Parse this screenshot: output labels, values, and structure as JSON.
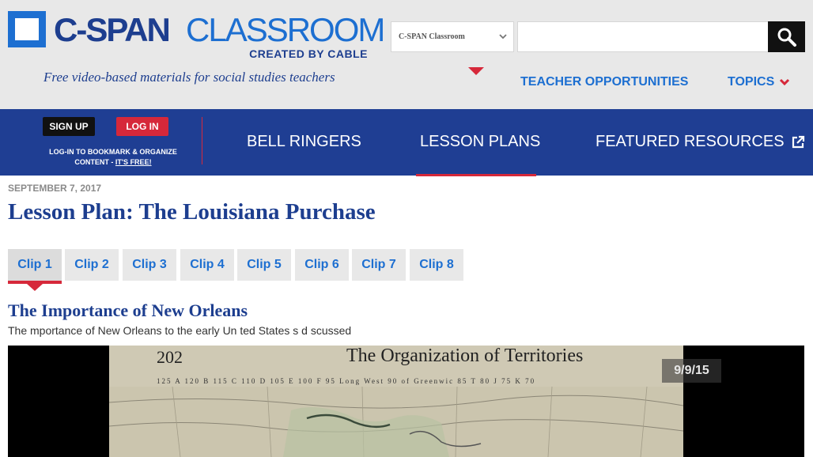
{
  "logo": {
    "brand_part1": "C-SPAN",
    "brand_part2": "CLASSROOM",
    "byline": "CREATED BY CABLE"
  },
  "header": {
    "tagline": "Free video-based materials for social studies teachers",
    "site_select_value": "C-SPAN Classroom",
    "search_placeholder": "",
    "teacher_opportunities": "TEACHER OPPORTUNITIES",
    "topics": "TOPICS"
  },
  "auth": {
    "signup": "SIGN UP",
    "login": "LOG IN",
    "note": "LOG-IN TO BOOKMARK & ORGANIZE CONTENT - ",
    "note_link": "IT'S FREE!"
  },
  "nav": {
    "items": [
      {
        "label": "BELL RINGERS"
      },
      {
        "label": "LESSON PLANS"
      },
      {
        "label": "FEATURED RESOURCES"
      }
    ],
    "active": "LESSON PLANS"
  },
  "content": {
    "date": "SEPTEMBER 7, 2017",
    "title": "Lesson Plan: The Louisiana Purchase",
    "clips": [
      "Clip 1",
      "Clip 2",
      "Clip 3",
      "Clip 4",
      "Clip 5",
      "Clip 6",
      "Clip 7",
      "Clip 8"
    ],
    "active_clip": "Clip 1",
    "clip_title": "The Importance of New Orleans",
    "clip_description": "The  mportance of New Orleans to the early Un ted States  s d scussed"
  },
  "video": {
    "page_number": "202",
    "map_heading": "The Organization of Territories",
    "scale_row": "125 A 120 B 115 C 110 D 105 E 100 F 95 Long West 90 of Greenwic 85 T 80 J 75 K 70",
    "date_stamp": "9/9/15"
  },
  "colors": {
    "brand_navy": "#1d3e8f",
    "brand_blue": "#1d6fd1",
    "accent_red": "#d6283a",
    "nav_bg": "#1f3e93",
    "header_bg": "#e8e8e8"
  }
}
